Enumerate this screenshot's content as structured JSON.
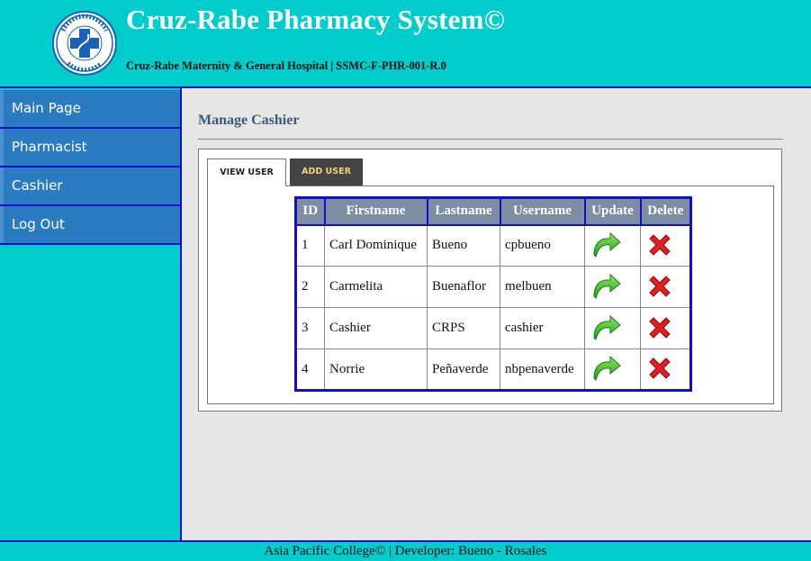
{
  "header": {
    "logo_text": "CRUZ - RABE PHARMACY SYSTEM",
    "title": "Cruz-Rabe Pharmacy System©",
    "subtitle": "Cruz-Rabe Maternity & General Hospital | SSMC-F-PHR-001-R.0"
  },
  "sidebar": {
    "items": [
      {
        "label": "Main Page"
      },
      {
        "label": "Pharmacist"
      },
      {
        "label": "Cashier"
      },
      {
        "label": "Log Out"
      }
    ]
  },
  "main": {
    "page_title": "Manage Cashier",
    "tabs": [
      {
        "label": "VIEW USER"
      },
      {
        "label": "ADD USER"
      }
    ],
    "table": {
      "headers": [
        "ID",
        "Firstname",
        "Lastname",
        "Username",
        "Update",
        "Delete"
      ],
      "rows": [
        {
          "id": "1",
          "firstname": "Carl Dominique",
          "lastname": "Bueno",
          "username": "cpbueno"
        },
        {
          "id": "2",
          "firstname": "Carmelita",
          "lastname": "Buenaflor",
          "username": "melbuen"
        },
        {
          "id": "3",
          "firstname": "Cashier",
          "lastname": "CRPS",
          "username": "cashier"
        },
        {
          "id": "4",
          "firstname": "Norrie",
          "lastname": "Peñaverde",
          "username": "nbpenaverde"
        }
      ],
      "update_icon": "refresh-arrow-icon",
      "delete_icon": "red-x-icon"
    }
  },
  "footer": {
    "text": "Asia Pacific College© | Developer: Bueno - Rosales"
  },
  "colors": {
    "background": "#00CCCC",
    "nav_item": "#2B7BC0",
    "border_blue": "#1010CC",
    "content_bg": "#E6E6E6",
    "table_header": "#7E8EA2",
    "active_tab_dark": "#444444"
  }
}
